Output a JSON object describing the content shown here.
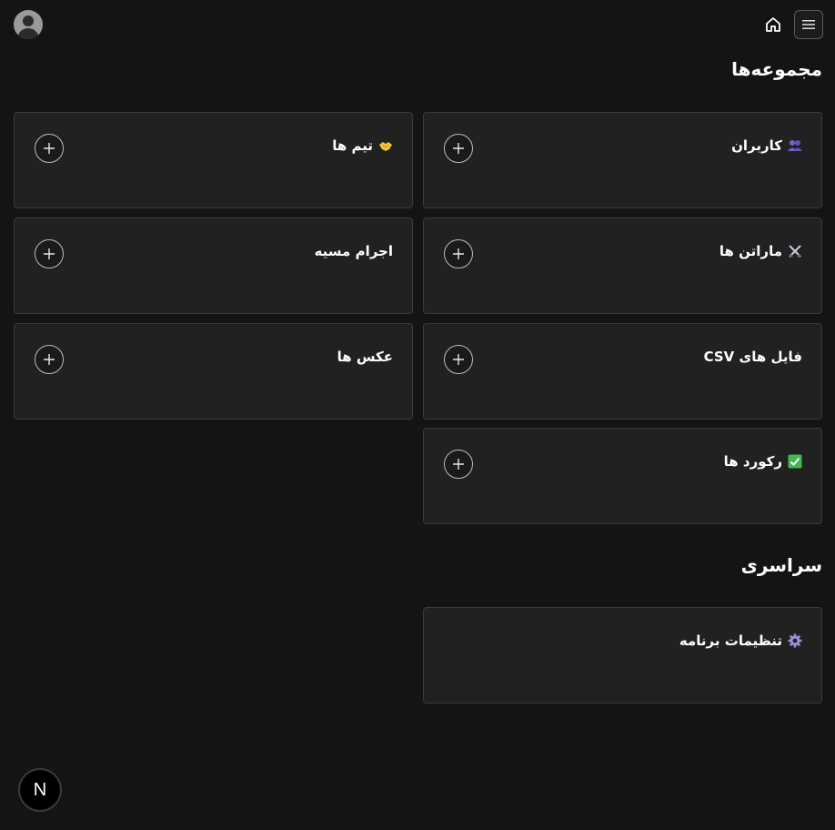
{
  "sections": {
    "collections_title": "مجموعه‌ها",
    "global_title": "سراسری"
  },
  "collections": [
    {
      "label": "کاربران",
      "icon": "people-icon"
    },
    {
      "label": "تیم ها",
      "icon": "handshake-icon"
    },
    {
      "label": "ماراتن ها",
      "icon": "crossed-swords-icon"
    },
    {
      "label": "اجرام مسیه",
      "icon": ""
    },
    {
      "label": "فایل های CSV",
      "icon": ""
    },
    {
      "label": "عکس ها",
      "icon": ""
    },
    {
      "label": "رکورد ها",
      "icon": "check-box-icon"
    }
  ],
  "globals": [
    {
      "label": "تنظیمات برنامه",
      "icon": "gear-icon"
    }
  ],
  "badge": {
    "letter": "N"
  },
  "colors": {
    "background": "#141414",
    "card": "#212121",
    "card_border": "#3a3a3a",
    "text": "#ffffff"
  }
}
